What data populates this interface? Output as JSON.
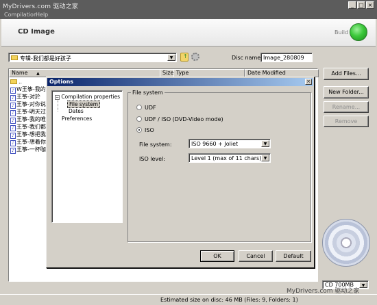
{
  "app": {
    "title": "MyDrivers.com 驱动之家",
    "menu": [
      "Compilation",
      "Help"
    ],
    "window_buttons": [
      "_",
      "□",
      "×"
    ]
  },
  "header": {
    "title": "CD Image",
    "build_label": "Build"
  },
  "toolbar": {
    "folder_combo_value": "专辑-我们都是好孩子",
    "disc_name_label": "Disc name:",
    "disc_name_value": "Image_280809"
  },
  "file_list": {
    "columns": [
      "Name",
      "Size",
      "Type",
      "Date Modified"
    ],
    "rows": [
      {
        "name": "..",
        "icon": "folder-up-icon"
      },
      {
        "name": "W王筝-我的",
        "icon": "audio-file-icon"
      },
      {
        "name": "王筝-对於",
        "icon": "audio-file-icon"
      },
      {
        "name": "王筝-对你说",
        "icon": "audio-file-icon"
      },
      {
        "name": "王筝-明天过",
        "icon": "audio-file-icon"
      },
      {
        "name": "王筝-我的唯",
        "icon": "audio-file-icon"
      },
      {
        "name": "王筝-我们都",
        "icon": "audio-file-icon"
      },
      {
        "name": "王筝-想把我",
        "icon": "audio-file-icon"
      },
      {
        "name": "王筝-想着你",
        "icon": "audio-file-icon"
      },
      {
        "name": "王筝-一杯咖",
        "icon": "audio-file-icon"
      }
    ]
  },
  "side_buttons": {
    "add_files": "Add Files...",
    "new_folder": "New Folder...",
    "rename": "Rename...",
    "remove": "Remove"
  },
  "disc_size": "CD 700MB",
  "status": {
    "text": "Estimated size on disc: 46 MB (Files: 9, Folders: 1)",
    "watermark": "MyDrivers.com 驱动之家"
  },
  "dialog": {
    "title": "Options",
    "tree": {
      "root": "Compilation properties",
      "children": [
        "File system",
        "Dates"
      ],
      "other": "Preferences"
    },
    "group_label": "File system",
    "options": [
      "UDF",
      "UDF / ISO (DVD-Video mode)",
      "ISO"
    ],
    "selected_option": "ISO",
    "filesystem_label": "File system:",
    "filesystem_value": "ISO 9660 + Joliet",
    "iso_level_label": "ISO level:",
    "iso_level_value": "Level 1 (max of 11 chars)",
    "ok": "OK",
    "cancel": "Cancel",
    "default": "Default"
  }
}
